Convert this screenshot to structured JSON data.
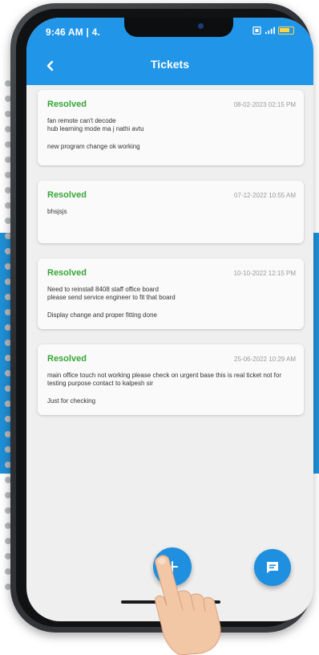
{
  "status_bar": {
    "time": "9:46 AM | 4.",
    "icons": [
      "sim-icon",
      "signal-icon",
      "battery-icon"
    ]
  },
  "app_bar": {
    "title": "Tickets",
    "back_icon": "back-arrow-icon"
  },
  "tickets": [
    {
      "status": "Resolved",
      "date": "08-02-2023 02:15 PM",
      "description": "fan remote can't decode\nhub learning mode ma j nathi avtu",
      "remark": "new program change ok working"
    },
    {
      "status": "Resolved",
      "date": "07-12-2022 10:55 AM",
      "description": "bhsjsjs",
      "remark": ""
    },
    {
      "status": "Resolved",
      "date": "10-10-2022 12:15 PM",
      "description": "Need to reinstall 8408 staff office board\nplease send service engineer to fit that board",
      "remark": "Display change and proper fitting done"
    },
    {
      "status": "Resolved",
      "date": "25-06-2022 10:29 AM",
      "description": "main office touch not working please check on urgent base this is real ticket not for testing purpose contact to kalpesh sir",
      "remark": "Just for checking"
    }
  ],
  "fab": {
    "add_icon": "plus-icon",
    "chat_icon": "chat-icon"
  },
  "colors": {
    "primary": "#2196e8",
    "resolved": "#35a635",
    "background": "#efefef",
    "band": "#1f8fd6"
  }
}
